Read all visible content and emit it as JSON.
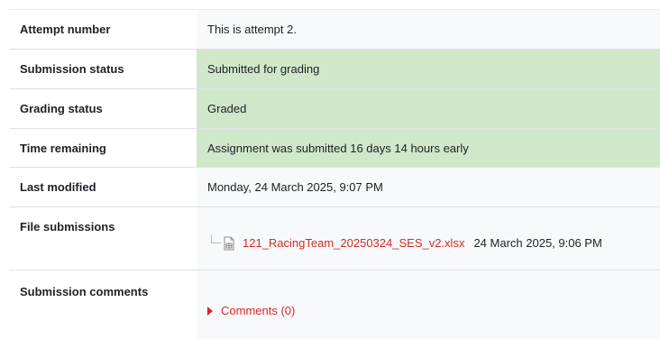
{
  "rows": {
    "attempt_number": {
      "label": "Attempt number",
      "value": "This is attempt 2."
    },
    "submission_status": {
      "label": "Submission status",
      "value": "Submitted for grading"
    },
    "grading_status": {
      "label": "Grading status",
      "value": "Graded"
    },
    "time_remaining": {
      "label": "Time remaining",
      "value": "Assignment was submitted 16 days 14 hours early"
    },
    "last_modified": {
      "label": "Last modified",
      "value": "Monday, 24 March 2025, 9:07 PM"
    },
    "file_submissions": {
      "label": "File submissions",
      "files": [
        {
          "name": "121_RacingTeam_20250324_SES_v2.xlsx",
          "date": "24 March 2025, 9:06 PM",
          "icon": "spreadsheet-file-icon"
        }
      ]
    },
    "submission_comments": {
      "label": "Submission comments",
      "link": "Comments (0)"
    }
  },
  "colors": {
    "success_bg": "#cfe8c9",
    "neutral_bg": "#f8f9fa",
    "link": "#d6292b"
  }
}
